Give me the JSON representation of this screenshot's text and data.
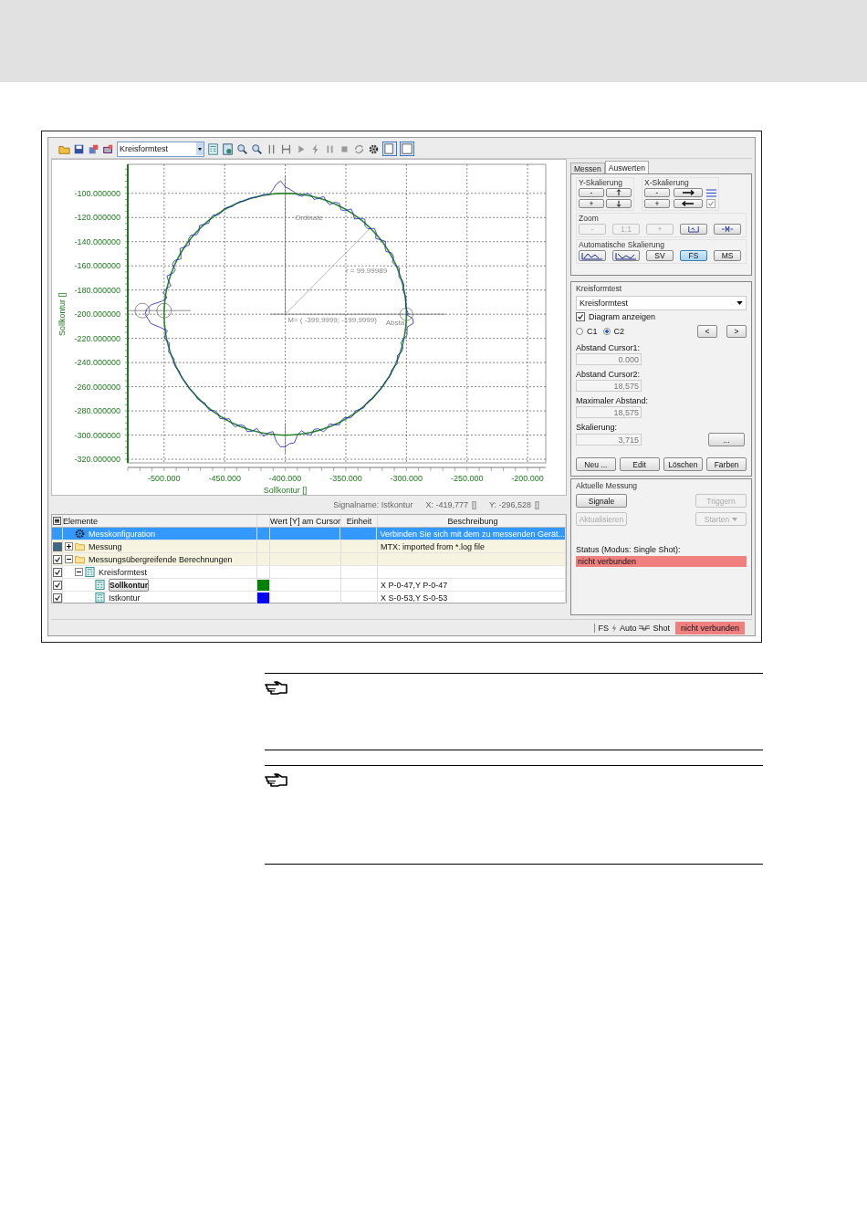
{
  "toolbar": {
    "combo": "Kreisformtest"
  },
  "chart": {
    "chart_data": {
      "type": "line",
      "xlabel": "Sollkontur []",
      "ylabel": "Sollkontur []",
      "xlim": [
        -530,
        -185
      ],
      "ylim": [
        -323,
        -76
      ],
      "xticks": [
        {
          "value": -500,
          "label": "-500.000"
        },
        {
          "value": -450,
          "label": "-450.000"
        },
        {
          "value": -400,
          "label": "-400.000"
        },
        {
          "value": -350,
          "label": "-350.000"
        },
        {
          "value": -300,
          "label": "-300.000"
        },
        {
          "value": -250,
          "label": "-250.000"
        },
        {
          "value": -200,
          "label": "-200.000"
        }
      ],
      "yticks": [
        {
          "value": -100,
          "label": "-100.000000"
        },
        {
          "value": -120,
          "label": "-120.000000"
        },
        {
          "value": -140,
          "label": "-140.000000"
        },
        {
          "value": -160,
          "label": "-160.000000"
        },
        {
          "value": -180,
          "label": "-180.000000"
        },
        {
          "value": -200,
          "label": "-200.000000"
        },
        {
          "value": -220,
          "label": "-220.000000"
        },
        {
          "value": -240,
          "label": "-240.000000"
        },
        {
          "value": -260,
          "label": "-260.000000"
        },
        {
          "value": -280,
          "label": "-280.000000"
        },
        {
          "value": -300,
          "label": "-300.000000"
        },
        {
          "value": -320,
          "label": "-320.000000"
        }
      ],
      "grid": true,
      "annotations": [
        "Ordinate",
        "r = 99.99989",
        "M= ( -399,9999; -199,9999)",
        "Absta"
      ]
    }
  },
  "signal_info": {
    "name": "Signalname: Istkontur",
    "x": "X: -419,777",
    "x_unit": "[]",
    "y": "Y: -296,528",
    "y_unit": "[]"
  },
  "table": {
    "columns": [
      "Elemente",
      "",
      "Wert [Y] am Cursor",
      "Einheit",
      "Beschreibung"
    ],
    "rows": [
      {
        "kind": "config",
        "label": "Messkonfiguration",
        "selected": true,
        "description": "Verbinden Sie sich mit dem zu messenden Gerät..."
      },
      {
        "kind": "group",
        "label": "Messung",
        "selected": false,
        "partial": true,
        "expanded": false,
        "description": "MTX: imported from *.log file"
      },
      {
        "kind": "group",
        "label": "Messungsübergreifende Berechnungen",
        "selected": false,
        "checked": true,
        "expanded": true,
        "children": [
          {
            "kind": "calculation",
            "label": "Kreisformtest",
            "selected": false,
            "checked": true,
            "expanded": true,
            "children": [
              {
                "kind": "signal",
                "label": "Sollkontur",
                "bold": true,
                "selected": false,
                "checked": true,
                "color": "#008000",
                "description": "X P-0-47,Y P-0-47"
              },
              {
                "kind": "signal",
                "label": "Istkontur",
                "bold": false,
                "selected": false,
                "checked": true,
                "color": "#0000ff",
                "description": "X S-0-53,Y S-0-53"
              }
            ]
          }
        ]
      }
    ]
  },
  "panel": {
    "tabs": [
      {
        "label": "Messen",
        "selected": false
      },
      {
        "label": "Auswerten",
        "selected": true
      }
    ],
    "y_scaling": {
      "title": "Y-Skalierung",
      "buttons": [
        "-",
        "+"
      ]
    },
    "x_scaling": {
      "title": "X-Skalierung",
      "buttons": [
        "-",
        "+"
      ],
      "checked": true
    },
    "zoom": {
      "title": "Zoom",
      "buttons": [
        {
          "label": "-",
          "disabled": true
        },
        {
          "label": "1:1",
          "disabled": true
        },
        {
          "label": "+",
          "disabled": true
        }
      ]
    },
    "auto_scaling": {
      "title": "Automatische Skalierung",
      "buttons": [
        {
          "label": "SV",
          "selected": false
        },
        {
          "label": "FS",
          "selected": true
        },
        {
          "label": "MS",
          "selected": false
        }
      ]
    },
    "evaluation": {
      "title": "Kreisformtest",
      "dropdown": "Kreisformtest",
      "show_diagram": {
        "label": "Diagram anzeigen",
        "checked": true
      },
      "radios": [
        {
          "label": "C1",
          "selected": false
        },
        {
          "label": "C2",
          "selected": true
        }
      ],
      "nav": [
        "<",
        ">"
      ],
      "fields": [
        {
          "label": "Abstand Cursor1:",
          "value": "0.000"
        },
        {
          "label": "Abstand Cursor2:",
          "value": "18,575"
        },
        {
          "label": "Maximaler Abstand:",
          "value": "18,575"
        },
        {
          "label": "Skalierung:",
          "value": "3,715"
        }
      ],
      "more": "...",
      "actions": [
        "Neu ...",
        "Edit",
        "Löschen",
        "Farben"
      ]
    },
    "measurement": {
      "title": "Aktuelle Messung",
      "buttons": [
        {
          "label": "Signale",
          "disabled": false
        },
        {
          "label": "Triggern",
          "disabled": true
        },
        {
          "label": "Aktualisieren",
          "disabled": true
        },
        {
          "label": "Starten",
          "disabled": true
        }
      ],
      "status_label": "Status (Modus: Single Shot):",
      "status": "nicht verbunden"
    }
  },
  "status_bar": {
    "items": [
      "FS",
      "Auto",
      "Shot"
    ],
    "connection": "nicht verbunden"
  }
}
